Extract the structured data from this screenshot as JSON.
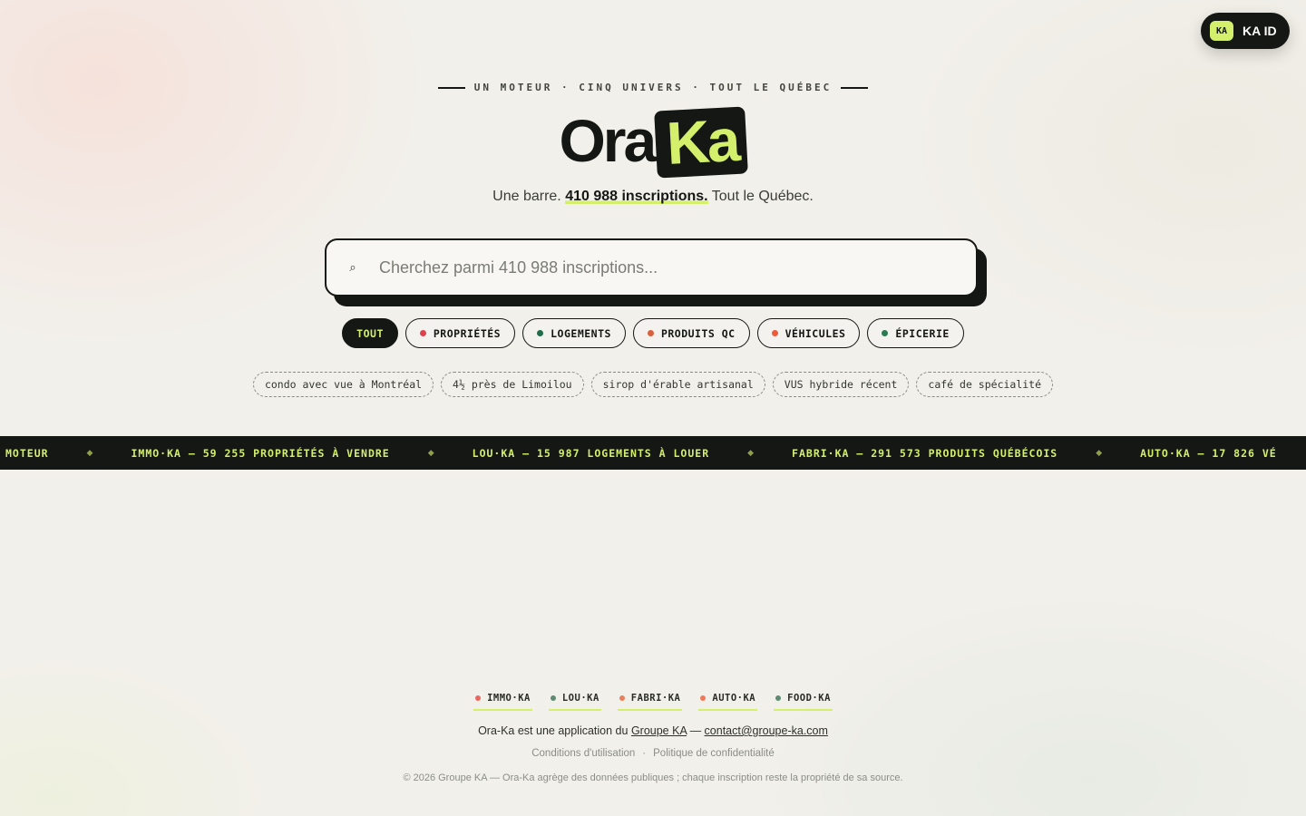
{
  "account": {
    "badge": "KA",
    "label": "KA ID"
  },
  "hero": {
    "eyebrow": "UN MOTEUR · CINQ UNIVERS · TOUT LE QUÉBEC",
    "logo_part1": "Ora",
    "logo_part2": "Ka",
    "tagline_before": "Une barre. ",
    "tagline_highlight": "410 988 inscriptions.",
    "tagline_after": " Tout le Québec."
  },
  "search": {
    "icon": "search-icon",
    "placeholder": "Cherchez parmi 410 988 inscriptions...",
    "value": ""
  },
  "categories": [
    {
      "label": "TOUT",
      "active": true,
      "dot": ""
    },
    {
      "label": "PROPRIÉTÉS",
      "active": false,
      "dot": "#e0414e"
    },
    {
      "label": "LOGEMENTS",
      "active": false,
      "dot": "#1f6b4a"
    },
    {
      "label": "PRODUITS QC",
      "active": false,
      "dot": "#d8603f"
    },
    {
      "label": "VÉHICULES",
      "active": false,
      "dot": "#ee5a3a"
    },
    {
      "label": "ÉPICERIE",
      "active": false,
      "dot": "#2a7a52"
    }
  ],
  "suggestions": [
    "condo avec vue à Montréal",
    "4½ près de Limoilou",
    "sirop d'érable artisanal",
    "VUS hybride récent",
    "café de spécialité"
  ],
  "ticker": [
    "MOTEUR",
    "IMMO·KA — 59 255 PROPRIÉTÉS À VENDRE",
    "LOU·KA — 15 987 LOGEMENTS À LOUER",
    "FABRI·KA — 291 573 PRODUITS QUÉBÉCOIS",
    "AUTO·KA — 17 826 VÉ"
  ],
  "ticker_separator": "◆",
  "footer": {
    "links": [
      {
        "label": "IMMO·KA",
        "dot": "#e8675e"
      },
      {
        "label": "LOU·KA",
        "dot": "#5f8a72"
      },
      {
        "label": "FABRI·KA",
        "dot": "#e8805e"
      },
      {
        "label": "AUTO·KA",
        "dot": "#ee7a5a"
      },
      {
        "label": "FOOD·KA",
        "dot": "#5f8a72"
      }
    ],
    "app_text": "Ora-Ka est une application du ",
    "group_link": "Groupe KA",
    "dash": " — ",
    "email": "contact@groupe-ka.com",
    "terms": "Conditions d'utilisation",
    "legal_sep": "·",
    "privacy": "Politique de confidentialité",
    "copyright": "© 2026 Groupe KA — Ora-Ka agrège des données publiques ; chaque inscription reste la propriété de sa source."
  },
  "colors": {
    "accent": "#d4ef6c",
    "ink": "#141713",
    "background": "#f2f0eb"
  }
}
